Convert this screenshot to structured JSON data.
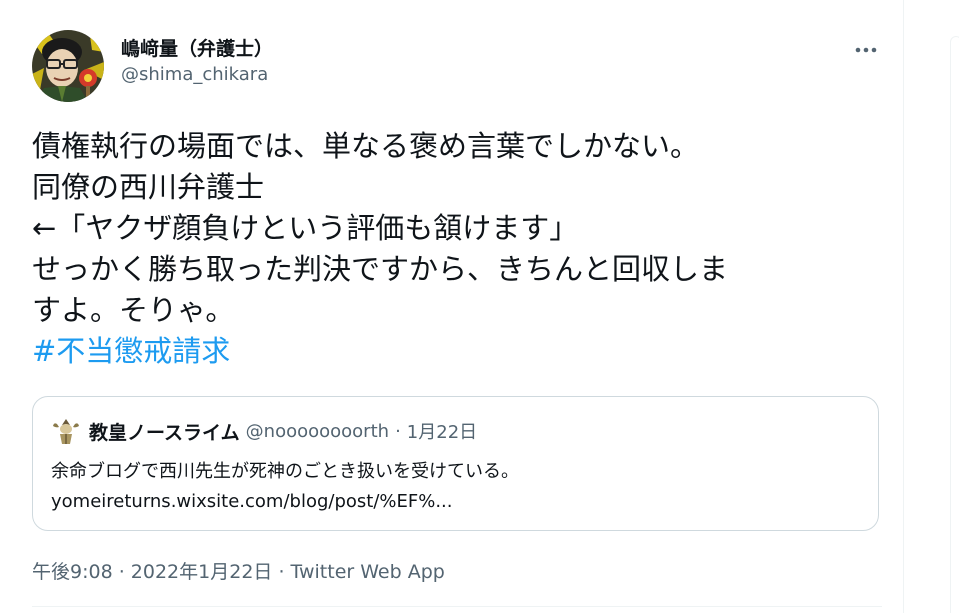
{
  "tweet": {
    "author": {
      "display_name": "嶋﨑量（弁護士）",
      "handle": "@shima_chikara"
    },
    "text_lines": [
      "債権執行の場面では、単なる褒め言葉でしかない。",
      "同僚の西川弁護士",
      "←「ヤクザ顔負けという評価も頷けます」",
      "せっかく勝ち取った判決ですから、きちんと回収しま",
      "すよ。そりゃ。"
    ],
    "hashtag": "#不当懲戒請求",
    "quote": {
      "display_name": "教皇ノースライム",
      "handle": "@noooooooorth",
      "separator": "·",
      "date": "1月22日",
      "body_line1": "余命ブログで西川先生が死神のごとき扱いを受けている。",
      "body_line2": "yomeireturns.wixsite.com/blog/post/%EF%..."
    },
    "meta": {
      "timestamp": "午後9:08 · 2022年1月22日 · ",
      "source_app": "Twitter Web App"
    }
  },
  "icons": {
    "more": "more-horizontal-icon"
  },
  "colors": {
    "link": "#1d9bf0",
    "secondary_text": "#536471",
    "border": "#cfd9de",
    "divider": "#eff3f4"
  }
}
